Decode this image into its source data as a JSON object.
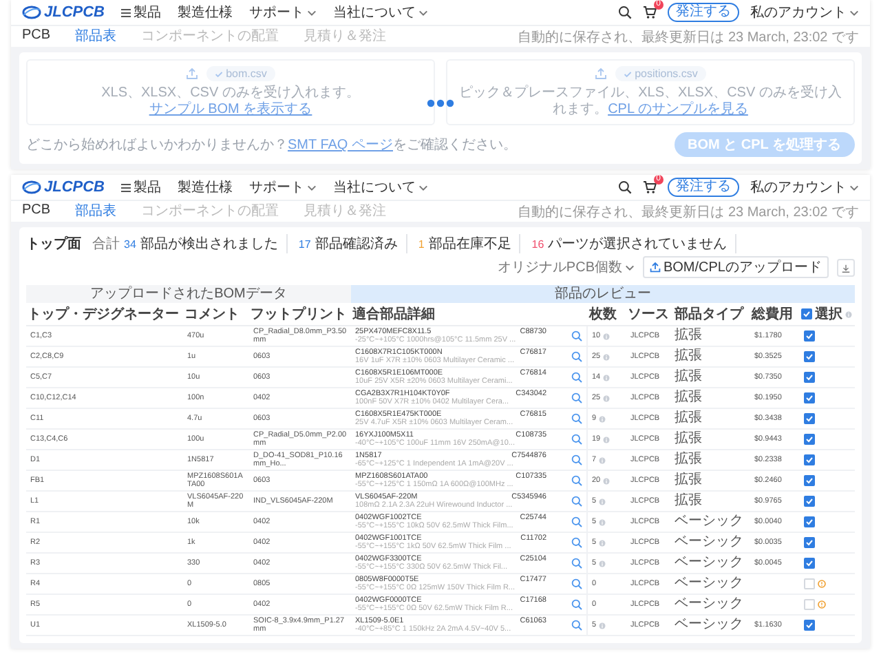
{
  "panels": [
    {
      "kind": "upload",
      "header": {
        "logo": "JLCPCB",
        "menu": [
          {
            "label": "製品",
            "kind": "grid"
          },
          {
            "label": "製造仕様",
            "kind": "plain"
          },
          {
            "label": "サポート",
            "kind": "dropdown"
          },
          {
            "label": "当社について",
            "kind": "dropdown"
          }
        ],
        "cart_count": "0",
        "order_button": "発注する",
        "account": "私のアカウント"
      },
      "tabs": [
        {
          "label": "PCB",
          "selected": false,
          "disabled": false
        },
        {
          "label": "部品表",
          "selected": true,
          "disabled": false
        },
        {
          "label": "コンポーネントの配置",
          "selected": false,
          "disabled": true
        },
        {
          "label": "見積り＆発注",
          "selected": false,
          "disabled": true
        }
      ],
      "saved_note": "自動的に保存され、最終更新日は 23 March, 23:02 です",
      "upload": {
        "loading": true,
        "files": [
          {
            "name": "bom.csv",
            "note": "XLS、XLSX、CSV のみを受け入れます。",
            "link": "サンプル BOM を表示する"
          },
          {
            "name": "positions.csv",
            "note": "ピック＆プレースファイル、XLS、XLSX、CSV のみを受け入れます。",
            "link": "CPL のサンプルを見る"
          }
        ],
        "help_prefix": "どこから始めればよいかわかりませんか？",
        "help_link": "SMT FAQ ページ",
        "help_suffix": "をご確認ください。",
        "process_button": "BOM と CPL を処理する"
      }
    },
    {
      "kind": "review",
      "header": {
        "logo": "JLCPCB",
        "menu": [
          {
            "label": "製品",
            "kind": "grid"
          },
          {
            "label": "製造仕様",
            "kind": "plain"
          },
          {
            "label": "サポート",
            "kind": "dropdown"
          },
          {
            "label": "当社について",
            "kind": "dropdown"
          }
        ],
        "cart_count": "0",
        "order_button": "発注する",
        "account": "私のアカウント"
      },
      "tabs": [
        {
          "label": "PCB",
          "selected": false,
          "disabled": false
        },
        {
          "label": "部品表",
          "selected": true,
          "disabled": false
        },
        {
          "label": "コンポーネントの配置",
          "selected": false,
          "disabled": true
        },
        {
          "label": "見積り＆発注",
          "selected": false,
          "disabled": true
        }
      ],
      "saved_note": "自動的に保存され、最終更新日は 23 March, 23:02 です",
      "review": {
        "side": "トップ面",
        "stats": [
          {
            "prefix": "合計",
            "count": "34",
            "text": "部品が検出されました",
            "color": "#2f7de1"
          },
          {
            "count": "17",
            "text": "部品確認済み",
            "color": "#2f7de1"
          },
          {
            "count": "1",
            "text": "部品在庫不足",
            "color": "#f0a030"
          },
          {
            "count": "16",
            "text": "パーツが選択されていません",
            "color": "#f0506e"
          }
        ],
        "pcb_quantity": "オリジナルPCB個数",
        "upload_button": "BOM/CPLのアップロード",
        "group_headers": [
          "アップロードされたBOMデータ",
          "部品のレビュー"
        ],
        "columns": [
          "トップ・デジグネーター",
          "コメント",
          "フットプリント",
          "適合部品詳細",
          "枚数",
          "ソース",
          "部品タイプ",
          "総費用",
          "選択"
        ],
        "select_all": true,
        "rows": [
          {
            "designator": "C1,C3",
            "comment": "470u",
            "footprint": "CP_Radial_D8.0mm_P3.50mm",
            "part": "25PX470MEFC8X11.5",
            "code": "C88730",
            "description": "-25°C~+105°C 1000hrs@105°C 11.5mm 25V ...",
            "quantity": "10",
            "info": true,
            "source": "JLCPCB",
            "type": "拡張",
            "price": "$1.1780",
            "selected": true,
            "warning": false
          },
          {
            "designator": "C2,C8,C9",
            "comment": "1u",
            "footprint": "0603",
            "part": "C1608X7R1C105KT000N",
            "code": "C76817",
            "description": "16V 1uF X7R ±10% 0603 Multilayer Ceramic ...",
            "quantity": "25",
            "info": true,
            "source": "JLCPCB",
            "type": "拡張",
            "price": "$0.3525",
            "selected": true,
            "warning": false
          },
          {
            "designator": "C5,C7",
            "comment": "10u",
            "footprint": "0603",
            "part": "C1608X5R1E106MT000E",
            "code": "C76814",
            "description": "10uF 25V X5R ±20% 0603 Multilayer Cerami...",
            "quantity": "14",
            "info": true,
            "source": "JLCPCB",
            "type": "拡張",
            "price": "$0.7350",
            "selected": true,
            "warning": false
          },
          {
            "designator": "C10,C12,C14",
            "comment": "100n",
            "footprint": "0402",
            "part": "CGA2B3X7R1H104KT0Y0F",
            "code": "C343042",
            "description": "100nF 50V X7R ±10% 0402 Multilayer Cera...",
            "quantity": "25",
            "info": true,
            "source": "JLCPCB",
            "type": "拡張",
            "price": "$0.1950",
            "selected": true,
            "warning": false
          },
          {
            "designator": "C11",
            "comment": "4.7u",
            "footprint": "0603",
            "part": "C1608X5R1E475KT000E",
            "code": "C76815",
            "description": "25V 4.7uF X5R ±10% 0603 Multilayer Ceram...",
            "quantity": "9",
            "info": true,
            "source": "JLCPCB",
            "type": "拡張",
            "price": "$0.3438",
            "selected": true,
            "warning": false
          },
          {
            "designator": "C13,C4,C6",
            "comment": "100u",
            "footprint": "CP_Radial_D5.0mm_P2.00mm",
            "part": "16YXJ100M5X11",
            "code": "C108735",
            "description": "-40°C~+105°C 100uF 11mm 16V 250mA@10...",
            "quantity": "19",
            "info": true,
            "source": "JLCPCB",
            "type": "拡張",
            "price": "$0.9443",
            "selected": true,
            "warning": false
          },
          {
            "designator": "D1",
            "comment": "1N5817",
            "footprint": "D_DO-41_SOD81_P10.16mm_Ho...",
            "part": "1N5817",
            "code": "C7544876",
            "description": "-65°C~+125°C 1 Independent 1A 1mA@20V ...",
            "quantity": "7",
            "info": true,
            "source": "JLCPCB",
            "type": "拡張",
            "price": "$0.2338",
            "selected": true,
            "warning": false
          },
          {
            "designator": "FB1",
            "comment": "MPZ1608S601ATA00",
            "footprint": "0603",
            "part": "MPZ1608S601ATA00",
            "code": "C107335",
            "description": "-55°C~+125°C 1 150mΩ 1A 600Ω@100MHz ...",
            "quantity": "20",
            "info": true,
            "source": "JLCPCB",
            "type": "拡張",
            "price": "$0.2460",
            "selected": true,
            "warning": false
          },
          {
            "designator": "L1",
            "comment": "VLS6045AF-220M",
            "footprint": "IND_VLS6045AF-220M",
            "part": "VLS6045AF-220M",
            "code": "C5345946",
            "description": "108mΩ 2.1A 2.3A 22uH Wirewound Inductor ...",
            "quantity": "5",
            "info": true,
            "source": "JLCPCB",
            "type": "拡張",
            "price": "$0.9765",
            "selected": true,
            "warning": false
          },
          {
            "designator": "R1",
            "comment": "10k",
            "footprint": "0402",
            "part": "0402WGF1002TCE",
            "code": "C25744",
            "description": "-55°C~+155°C 10kΩ 50V 62.5mW Thick Film...",
            "quantity": "5",
            "info": true,
            "source": "JLCPCB",
            "type": "ベーシック",
            "price": "$0.0040",
            "selected": true,
            "warning": false
          },
          {
            "designator": "R2",
            "comment": "1k",
            "footprint": "0402",
            "part": "0402WGF1001TCE",
            "code": "C11702",
            "description": "-55°C~+155°C 1kΩ 50V 62.5mW Thick Film ...",
            "quantity": "5",
            "info": true,
            "source": "JLCPCB",
            "type": "ベーシック",
            "price": "$0.0035",
            "selected": true,
            "warning": false
          },
          {
            "designator": "R3",
            "comment": "330",
            "footprint": "0402",
            "part": "0402WGF3300TCE",
            "code": "C25104",
            "description": "-55°C~+155°C 330Ω 50V 62.5mW Thick Fil...",
            "quantity": "5",
            "info": true,
            "source": "JLCPCB",
            "type": "ベーシック",
            "price": "$0.0045",
            "selected": true,
            "warning": false
          },
          {
            "designator": "R4",
            "comment": "0",
            "footprint": "0805",
            "part": "0805W8F0000T5E",
            "code": "C17477",
            "description": "-55°C~+155°C 0Ω 125mW 150V Thick Film R...",
            "quantity": "0",
            "info": false,
            "source": "JLCPCB",
            "type": "ベーシック",
            "selected": false,
            "warning": true
          },
          {
            "designator": "R5",
            "comment": "0",
            "footprint": "0402",
            "part": "0402WGF0000TCE",
            "code": "C17168",
            "description": "-55°C~+155°C 0Ω 50V 62.5mW Thick Film R...",
            "quantity": "0",
            "info": false,
            "source": "JLCPCB",
            "type": "ベーシック",
            "selected": false,
            "warning": true
          },
          {
            "designator": "U1",
            "comment": "XL1509-5.0",
            "footprint": "SOIC-8_3.9x4.9mm_P1.27mm",
            "part": "XL1509-5.0E1",
            "code": "C61063",
            "description": "-40°C~+85°C 1 150kHz 2A 2mA 4.5V~40V 5...",
            "quantity": "5",
            "info": true,
            "source": "JLCPCB",
            "type": "ベーシック",
            "price": "$1.1630",
            "selected": true,
            "warning": false
          }
        ]
      }
    }
  ]
}
